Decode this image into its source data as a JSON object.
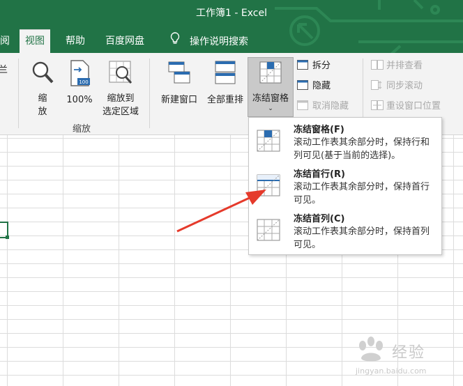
{
  "window": {
    "title": "工作簿1  -  Excel"
  },
  "tabs": [
    {
      "label": "阅",
      "active": false
    },
    {
      "label": "视图",
      "active": true
    },
    {
      "label": "帮助",
      "active": false
    },
    {
      "label": "百度网盘",
      "active": false
    },
    {
      "label": "操作说明搜索",
      "active": false,
      "icon": "lightbulb-icon"
    }
  ],
  "ribbon": {
    "left_cut_label": "兰",
    "zoom_group": {
      "label": "缩放",
      "zoom_btn_line1": "缩",
      "zoom_btn_line2": "放",
      "zoom100_label": "100%",
      "zoom_selection_line1": "缩放到",
      "zoom_selection_line2": "选定区域",
      "icon_badge": "100"
    },
    "window_group": {
      "new_window": "新建窗口",
      "arrange_all": "全部重排",
      "freeze_panes": "冻结窗格",
      "split": "拆分",
      "hide": "隐藏",
      "unhide": "取消隐藏",
      "view_side_by_side": "并排查看",
      "sync_scroll": "同步滚动",
      "reset_position": "重设窗口位置"
    }
  },
  "freeze_menu": {
    "items": [
      {
        "title": "冻结窗格(F)",
        "desc": "滚动工作表其余部分时，保持行和列可见(基于当前的选择)。"
      },
      {
        "title": "冻结首行(R)",
        "desc": "滚动工作表其余部分时，保持首行可见。"
      },
      {
        "title": "冻结首列(C)",
        "desc": "滚动工作表其余部分时，保持首列可见。"
      }
    ]
  },
  "watermark": {
    "text": "经验",
    "sub": "jingyan.baidu.com"
  },
  "colors": {
    "excel_green": "#217346",
    "arrow_red": "#e53a2b"
  }
}
